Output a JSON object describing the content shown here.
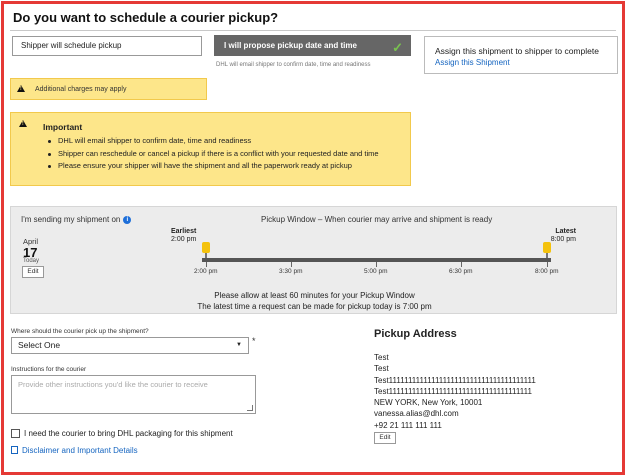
{
  "title": "Do you want to schedule a courier pickup?",
  "options": {
    "shipper_label": "Shipper will schedule pickup",
    "propose_label": "I will propose pickup date and time",
    "propose_note": "DHL will email shipper to confirm date, time and readiness"
  },
  "assign": {
    "title": "Assign this shipment to shipper to complete",
    "link": "Assign this Shipment"
  },
  "charges_warning": "Additional charges may apply",
  "important": {
    "heading": "Important",
    "items": [
      "DHL will email shipper to confirm date, time and readiness",
      "Shipper can reschedule or cancel a pickup if there is a conflict with your requested date and time",
      "Please ensure your shipper will have the shipment and all the paperwork ready at pickup"
    ]
  },
  "schedule": {
    "sending_label": "I'm sending my shipment on",
    "window_title": "Pickup Window – When courier may arrive and shipment is ready",
    "month": "April",
    "day": "17",
    "day_note": "Today",
    "edit": "Edit",
    "earliest_label": "Earliest",
    "earliest_time": "2:00 pm",
    "latest_label": "Latest",
    "latest_time": "8:00 pm",
    "ticks": [
      "2:00 pm",
      "3:30 pm",
      "5:00 pm",
      "6:30 pm",
      "8:00 pm"
    ],
    "note1": "Please allow at least 60 minutes for your Pickup Window",
    "note2": "The latest time a request can be made for pickup today is 7:00 pm"
  },
  "form": {
    "where_label": "Where should the courier pick up the shipment?",
    "where_value": "Select One",
    "required": "*",
    "instructions_label": "Instructions for the courier",
    "instructions_placeholder": "Provide other instructions you'd like the courier to receive",
    "packaging_label": "I need the courier to bring DHL packaging for this shipment",
    "disclaimer": "Disclaimer and Important Details"
  },
  "pickup_address": {
    "title": "Pickup Address",
    "lines": [
      "Test",
      "Test",
      "Test11111111111111111111111111111111111111",
      "Test1111111111111111111111111111111111111",
      "NEW YORK, New York, 10001",
      "vanessa.alias@dhl.com",
      "+92 21 111 111 111"
    ],
    "edit": "Edit"
  }
}
